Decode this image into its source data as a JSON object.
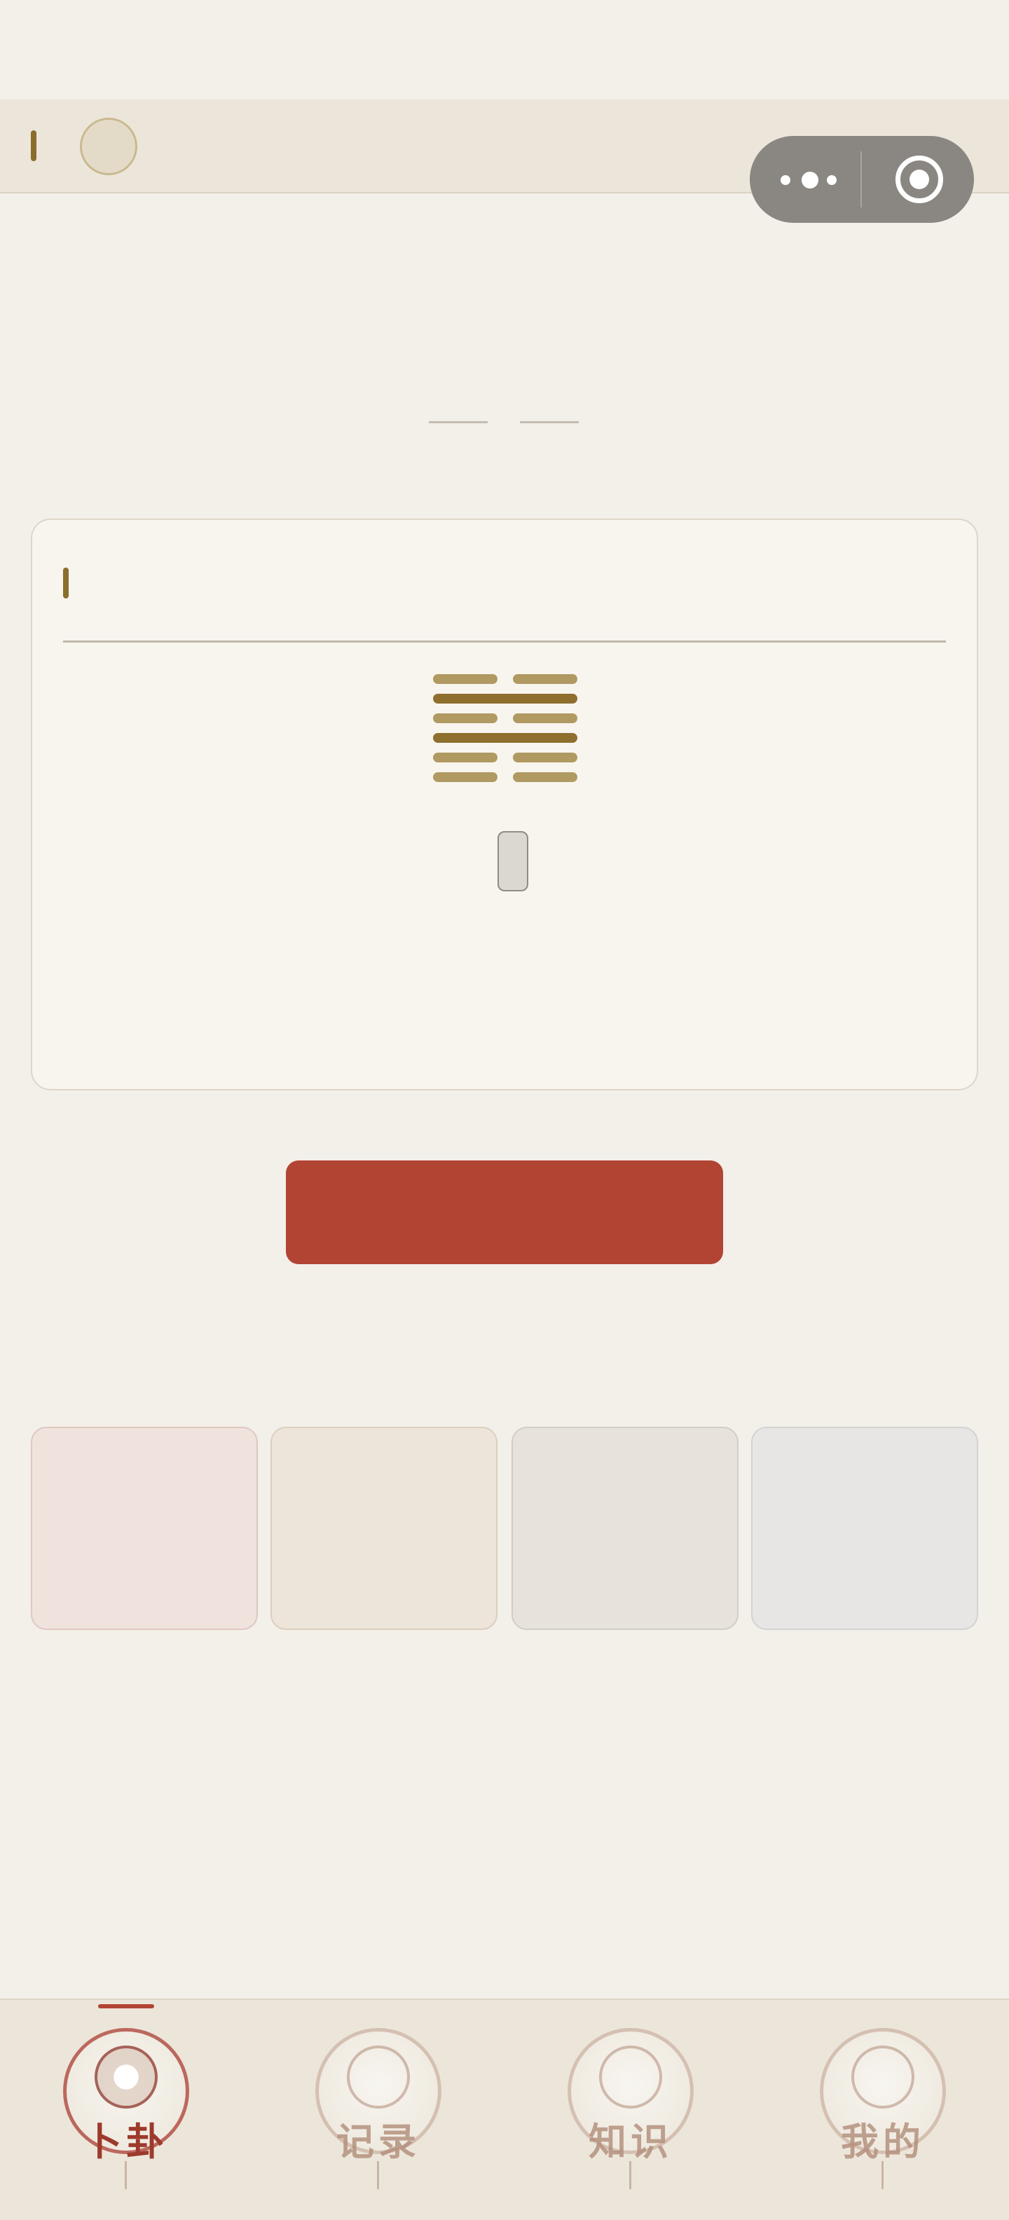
{
  "colors": {
    "background": "#f3efe9",
    "accent_gold": "#8b6d2c",
    "primary_red": "#b24434"
  },
  "hexagram": {
    "lines_top_to_bottom": [
      "yin",
      "yang",
      "yin",
      "yang",
      "yin",
      "yin"
    ]
  },
  "tabbar": {
    "active_index": 0,
    "items": [
      {
        "label": "卜卦",
        "icon": "bagua-medallion-icon"
      },
      {
        "label": "记录",
        "icon": "scroll-icon"
      },
      {
        "label": "知识",
        "icon": "open-book-icon"
      },
      {
        "label": "我的",
        "icon": "compass-medallion-icon"
      }
    ]
  }
}
